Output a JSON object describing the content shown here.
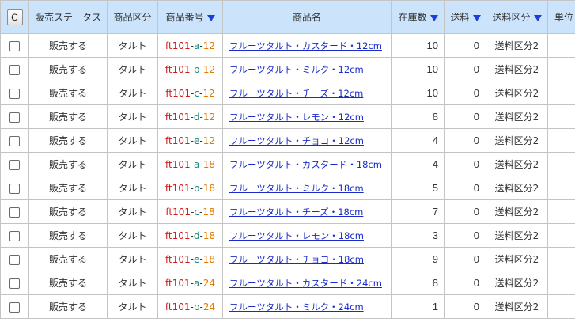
{
  "header": {
    "check_button": "C",
    "sales_status": "販売ステータス",
    "category": "商品区分",
    "product_code": "商品番号",
    "product_name": "商品名",
    "stock": "在庫数",
    "shipping": "送料",
    "shipping_class": "送料区分",
    "unit": "単位"
  },
  "colors": {
    "header_bg": "#cbe4fb",
    "sort_arrow": "#1e3fd6",
    "code_prefix": "#d11a1a",
    "code_variant": "#16887a",
    "code_size": "#e07b00",
    "link": "#1a2cc7"
  },
  "rows": [
    {
      "status": "販売する",
      "category": "タルト",
      "code_prefix": "ft101",
      "code_variant": "a",
      "code_size": "12",
      "name": "フルーツタルト・カスタード・12cm",
      "stock": "10",
      "shipping": "0",
      "shipping_class": "送料区分2",
      "unit": ""
    },
    {
      "status": "販売する",
      "category": "タルト",
      "code_prefix": "ft101",
      "code_variant": "b",
      "code_size": "12",
      "name": "フルーツタルト・ミルク・12cm",
      "stock": "10",
      "shipping": "0",
      "shipping_class": "送料区分2",
      "unit": ""
    },
    {
      "status": "販売する",
      "category": "タルト",
      "code_prefix": "ft101",
      "code_variant": "c",
      "code_size": "12",
      "name": "フルーツタルト・チーズ・12cm",
      "stock": "10",
      "shipping": "0",
      "shipping_class": "送料区分2",
      "unit": ""
    },
    {
      "status": "販売する",
      "category": "タルト",
      "code_prefix": "ft101",
      "code_variant": "d",
      "code_size": "12",
      "name": "フルーツタルト・レモン・12cm",
      "stock": "8",
      "shipping": "0",
      "shipping_class": "送料区分2",
      "unit": ""
    },
    {
      "status": "販売する",
      "category": "タルト",
      "code_prefix": "ft101",
      "code_variant": "e",
      "code_size": "12",
      "name": "フルーツタルト・チョコ・12cm",
      "stock": "4",
      "shipping": "0",
      "shipping_class": "送料区分2",
      "unit": ""
    },
    {
      "status": "販売する",
      "category": "タルト",
      "code_prefix": "ft101",
      "code_variant": "a",
      "code_size": "18",
      "name": "フルーツタルト・カスタード・18cm",
      "stock": "4",
      "shipping": "0",
      "shipping_class": "送料区分2",
      "unit": ""
    },
    {
      "status": "販売する",
      "category": "タルト",
      "code_prefix": "ft101",
      "code_variant": "b",
      "code_size": "18",
      "name": "フルーツタルト・ミルク・18cm",
      "stock": "5",
      "shipping": "0",
      "shipping_class": "送料区分2",
      "unit": ""
    },
    {
      "status": "販売する",
      "category": "タルト",
      "code_prefix": "ft101",
      "code_variant": "c",
      "code_size": "18",
      "name": "フルーツタルト・チーズ・18cm",
      "stock": "7",
      "shipping": "0",
      "shipping_class": "送料区分2",
      "unit": ""
    },
    {
      "status": "販売する",
      "category": "タルト",
      "code_prefix": "ft101",
      "code_variant": "d",
      "code_size": "18",
      "name": "フルーツタルト・レモン・18cm",
      "stock": "3",
      "shipping": "0",
      "shipping_class": "送料区分2",
      "unit": ""
    },
    {
      "status": "販売する",
      "category": "タルト",
      "code_prefix": "ft101",
      "code_variant": "e",
      "code_size": "18",
      "name": "フルーツタルト・チョコ・18cm",
      "stock": "9",
      "shipping": "0",
      "shipping_class": "送料区分2",
      "unit": ""
    },
    {
      "status": "販売する",
      "category": "タルト",
      "code_prefix": "ft101",
      "code_variant": "a",
      "code_size": "24",
      "name": "フルーツタルト・カスタード・24cm",
      "stock": "8",
      "shipping": "0",
      "shipping_class": "送料区分2",
      "unit": ""
    },
    {
      "status": "販売する",
      "category": "タルト",
      "code_prefix": "ft101",
      "code_variant": "b",
      "code_size": "24",
      "name": "フルーツタルト・ミルク・24cm",
      "stock": "1",
      "shipping": "0",
      "shipping_class": "送料区分2",
      "unit": ""
    }
  ]
}
